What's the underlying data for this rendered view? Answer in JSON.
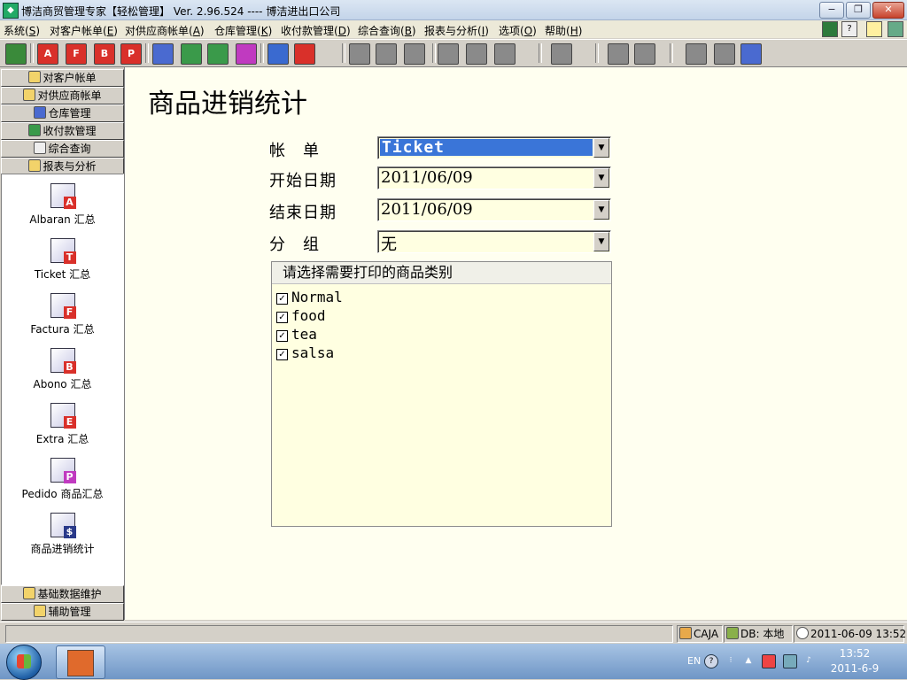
{
  "window": {
    "title": "博洁商贸管理专家【轻松管理】 Ver. 2.96.524 ---- 博洁进出口公司",
    "min_label": "−",
    "max_label": "❐",
    "close_label": "✕"
  },
  "menu": [
    {
      "label": "系统(",
      "key": "S",
      "suffix": ")"
    },
    {
      "label": "对客户帐单(",
      "key": "E",
      "suffix": ")"
    },
    {
      "label": "对供应商帐单(",
      "key": "A",
      "suffix": ")"
    },
    {
      "label": "仓库管理(",
      "key": "K",
      "suffix": ")"
    },
    {
      "label": "收付款管理(",
      "key": "D",
      "suffix": ")"
    },
    {
      "label": "综合查询(",
      "key": "B",
      "suffix": ")"
    },
    {
      "label": "报表与分析(",
      "key": "I",
      "suffix": ")"
    },
    {
      "label": "选项(",
      "key": "O",
      "suffix": ")"
    },
    {
      "label": "帮助(",
      "key": "H",
      "suffix": ")"
    }
  ],
  "toolbar_letters": [
    "A",
    "F",
    "B",
    "P"
  ],
  "sidebar": {
    "sections": [
      "对客户帐单",
      "对供应商帐单",
      "仓库管理",
      "收付款管理",
      "综合查询",
      "报表与分析"
    ],
    "items": [
      {
        "label": "Albaran 汇总",
        "badge": "A",
        "color": "#d9302a"
      },
      {
        "label": "Ticket 汇总",
        "badge": "T",
        "color": "#d9302a"
      },
      {
        "label": "Factura 汇总",
        "badge": "F",
        "color": "#d9302a"
      },
      {
        "label": "Abono 汇总",
        "badge": "B",
        "color": "#d9302a"
      },
      {
        "label": "Extra 汇总",
        "badge": "E",
        "color": "#d9302a"
      },
      {
        "label": "Pedido 商品汇总",
        "badge": "P",
        "color": "#c03ac0"
      },
      {
        "label": "商品进销统计",
        "badge": "$",
        "color": "#2a3a8a"
      }
    ],
    "bottom_sections": [
      "基础数据维护",
      "辅助管理"
    ]
  },
  "form": {
    "page_title": "商品进销统计",
    "fields": [
      {
        "label": "帐　单",
        "value": "Ticket"
      },
      {
        "label": "开始日期",
        "value": "2011/06/09"
      },
      {
        "label": "结束日期",
        "value": "2011/06/09"
      },
      {
        "label": "分　组",
        "value": "无"
      }
    ],
    "category_header": "请选择需要打印的商品类别",
    "categories": [
      {
        "label": "Normal",
        "checked": true
      },
      {
        "label": "food",
        "checked": true
      },
      {
        "label": "tea",
        "checked": true
      },
      {
        "label": "salsa",
        "checked": true
      }
    ]
  },
  "statusbar": {
    "caja": "CAJA",
    "db": "DB: 本地",
    "datetime": "2011-06-09 13:52"
  },
  "taskbar": {
    "lang": "EN",
    "time": "13:52",
    "date": "2011-6-9"
  }
}
